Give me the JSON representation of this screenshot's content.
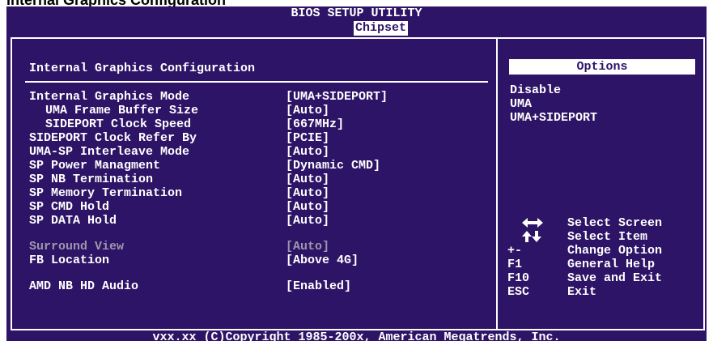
{
  "page_heading": "Internal Graphics Configuration",
  "bios": {
    "title": "BIOS SETUP UTILITY",
    "active_tab": "Chipset",
    "footer": "vxx.xx (C)Copyright 1985-200x, American Megatrends, Inc."
  },
  "panel": {
    "title": "Internal Graphics Configuration",
    "items": [
      {
        "label": "Internal Graphics Mode",
        "value": "[UMA+SIDEPORT]"
      },
      {
        "label": "UMA Frame Buffer Size",
        "value": "[Auto]"
      },
      {
        "label": "SIDEPORT Clock Speed",
        "value": "[667MHz]"
      },
      {
        "label": "SIDEPORT Clock Refer By",
        "value": "[PCIE]"
      },
      {
        "label": "UMA-SP Interleave Mode",
        "value": "[Auto]"
      },
      {
        "label": "SP Power Managment",
        "value": "[Dynamic CMD]"
      },
      {
        "label": "SP NB Termination",
        "value": "[Auto]"
      },
      {
        "label": "SP Memory Termination",
        "value": "[Auto]"
      },
      {
        "label": "SP CMD Hold",
        "value": "[Auto]"
      },
      {
        "label": "SP DATA Hold",
        "value": "[Auto]"
      },
      {
        "label": "Surround View",
        "value": "[Auto]"
      },
      {
        "label": "FB Location",
        "value": "[Above 4G]"
      },
      {
        "label": "AMD NB HD Audio",
        "value": "[Enabled]"
      }
    ]
  },
  "options": {
    "header": "Options",
    "list": [
      "Disable",
      "UMA",
      "UMA+SIDEPORT"
    ]
  },
  "help": {
    "select_screen": "Select Screen",
    "select_item": "Select Item",
    "change_option_key": "+-",
    "change_option": "Change Option",
    "general_help_key": "F1",
    "general_help": "General Help",
    "save_exit_key": "F10",
    "save_exit": "Save and Exit",
    "exit_key": "ESC",
    "exit": "Exit"
  },
  "colors": {
    "background": "#2e1467",
    "text": "#ffffff",
    "disabled_text": "#9c97ab",
    "page": "#ffffff"
  }
}
